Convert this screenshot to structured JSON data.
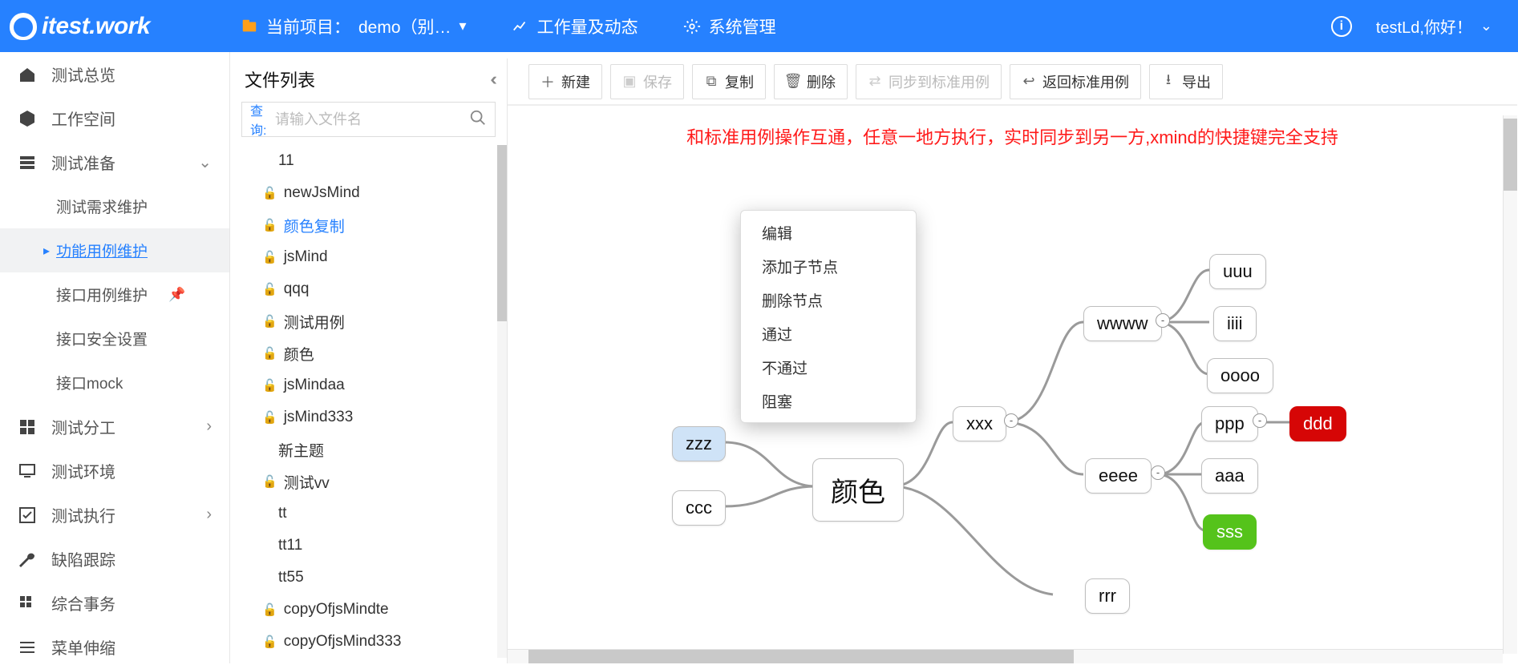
{
  "brand": "itest.work",
  "topbar": {
    "project_prefix": "当前项目：",
    "project_name": "demo（别…",
    "workload": "工作量及动态",
    "admin": "系统管理",
    "greeting": "testLd,你好！"
  },
  "sidebar": {
    "items": [
      {
        "label": "测试总览"
      },
      {
        "label": "工作空间"
      },
      {
        "label": "测试准备",
        "expanded": true,
        "children": [
          {
            "label": "测试需求维护"
          },
          {
            "label": "功能用例维护",
            "active": true
          },
          {
            "label": "接口用例维护",
            "pinned": true
          },
          {
            "label": "接口安全设置"
          },
          {
            "label": "接口mock"
          }
        ]
      },
      {
        "label": "测试分工",
        "arrow": true
      },
      {
        "label": "测试环境"
      },
      {
        "label": "测试执行",
        "arrow": true
      },
      {
        "label": "缺陷跟踪"
      },
      {
        "label": "综合事务"
      },
      {
        "label": "菜单伸缩"
      }
    ]
  },
  "filelist": {
    "title": "文件列表",
    "query_label": "查询:",
    "placeholder": "请输入文件名",
    "items": [
      {
        "label": "11",
        "lock": false,
        "indent": true
      },
      {
        "label": "newJsMind",
        "lock": true
      },
      {
        "label": "颜色复制",
        "lock": true,
        "selected": true
      },
      {
        "label": "jsMind",
        "lock": true
      },
      {
        "label": "qqq",
        "lock": true
      },
      {
        "label": "测试用例",
        "lock": true
      },
      {
        "label": "颜色",
        "lock": true
      },
      {
        "label": "jsMindaa",
        "lock": true
      },
      {
        "label": "jsMind333",
        "lock": true
      },
      {
        "label": "新主题",
        "lock": false,
        "indent": true
      },
      {
        "label": "测试vv",
        "lock": true
      },
      {
        "label": "tt",
        "lock": false,
        "indent": true
      },
      {
        "label": "tt11",
        "lock": false,
        "indent": true
      },
      {
        "label": "tt55",
        "lock": false,
        "indent": true
      },
      {
        "label": "copyOfjsMindte",
        "lock": true
      },
      {
        "label": "copyOfjsMind333",
        "lock": true
      }
    ]
  },
  "toolbar": {
    "new": "新建",
    "save": "保存",
    "copy": "复制",
    "delete": "删除",
    "sync": "同步到标准用例",
    "back": "返回标准用例",
    "export": "导出"
  },
  "banner": "和标准用例操作互通，任意一地方执行，实时同步到另一方,xmind的快捷键完全支持",
  "context_menu": {
    "items": [
      "编辑",
      "添加子节点",
      "删除节点",
      "通过",
      "不通过",
      "阻塞"
    ]
  },
  "mindmap": {
    "root": "颜色",
    "left": [
      "zzz",
      "ccc"
    ],
    "xxx": "xxx",
    "wwww": "wwww",
    "eeee": "eeee",
    "ppp": "ppp",
    "aaa": "aaa",
    "sss": "sss",
    "uuu": "uuu",
    "iiii": "iiii",
    "oooo": "oooo",
    "ddd": "ddd",
    "rrr": "rrr"
  }
}
